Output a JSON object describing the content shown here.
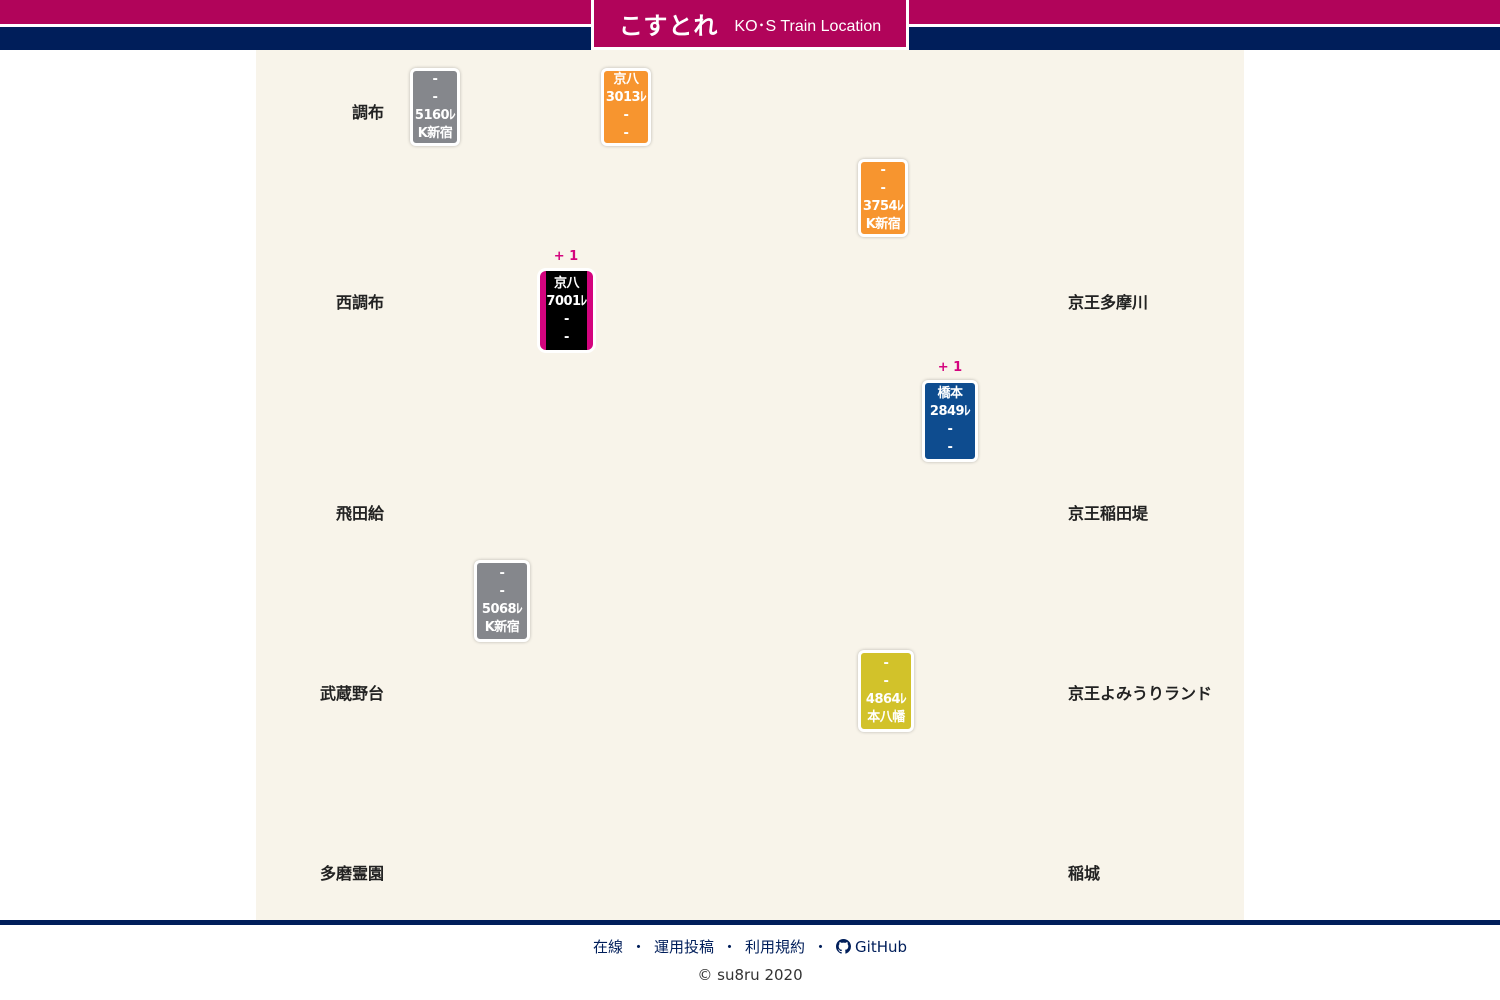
{
  "header": {
    "app_name": "こすとれ",
    "app_subtitle": "KO･S Train Location",
    "colors": {
      "primary": "#b1045a",
      "navy": "#001e5a"
    }
  },
  "stations_left": [
    "調布",
    "西調布",
    "飛田給",
    "武蔵野台",
    "多磨霊園"
  ],
  "stations_right": [
    "京王多摩川",
    "京王稲田堤",
    "京王よみうりランド",
    "稲城"
  ],
  "trains": [
    {
      "color": "gray",
      "lines": [
        "-",
        "-",
        "5160ﾚ",
        "K新宿"
      ],
      "badge": ""
    },
    {
      "color": "orange",
      "lines": [
        "京八",
        "3013ﾚ",
        "-",
        "-"
      ],
      "badge": ""
    },
    {
      "color": "orange",
      "lines": [
        "-",
        "-",
        "3754ﾚ",
        "K新宿"
      ],
      "badge": ""
    },
    {
      "color": "black",
      "lines": [
        "京八",
        "7001ﾚ",
        "-",
        "-"
      ],
      "badge": "+ 1"
    },
    {
      "color": "navy",
      "lines": [
        "橋本",
        "2849ﾚ",
        "-",
        "-"
      ],
      "badge": "+ 1"
    },
    {
      "color": "gray",
      "lines": [
        "-",
        "-",
        "5068ﾚ",
        "K新宿"
      ],
      "badge": ""
    },
    {
      "color": "yellow",
      "lines": [
        "-",
        "-",
        "4864ﾚ",
        "本八幡"
      ],
      "badge": ""
    }
  ],
  "footer": {
    "links": [
      "在線",
      "運用投稿",
      "利用規約",
      "GitHub"
    ],
    "separator": "・",
    "github_icon": "github-icon",
    "copyright": "© su8ru 2020"
  }
}
